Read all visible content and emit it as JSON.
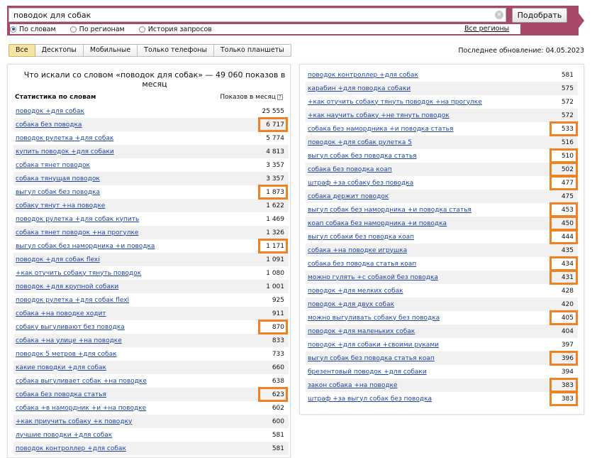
{
  "search": {
    "query": "поводок для собак",
    "submit_label": "Подобрать",
    "clear_icon": "clear-icon",
    "radios": [
      {
        "label": "По словам",
        "selected": true
      },
      {
        "label": "По регионам",
        "selected": false
      },
      {
        "label": "История запросов",
        "selected": false
      }
    ],
    "regions_link": "Все регионы"
  },
  "tabs": [
    "Все",
    "Десктопы",
    "Мобильные",
    "Только телефоны",
    "Только планшеты"
  ],
  "active_tab": "Все",
  "last_update": "Последнее обновление: 04.05.2023",
  "left_panel": {
    "title": "Что искали со словом «поводок для собак» — 49 060 показов в месяц",
    "col_words": "Статистика по словам",
    "col_shows": "Показов в месяц",
    "rows": [
      {
        "phrase": "поводок +для собак",
        "count": "25 555",
        "highlight": false
      },
      {
        "phrase": "собака без поводка",
        "count": "6 717",
        "highlight": true
      },
      {
        "phrase": "поводок рулетка +для собак",
        "count": "5 774",
        "highlight": false
      },
      {
        "phrase": "купить поводок +для собаки",
        "count": "4 813",
        "highlight": false
      },
      {
        "phrase": "собака тянет поводок",
        "count": "3 357",
        "highlight": false
      },
      {
        "phrase": "собака тянущая поводок",
        "count": "3 357",
        "highlight": false
      },
      {
        "phrase": "выгул собак без поводка",
        "count": "1 873",
        "highlight": true
      },
      {
        "phrase": "собаку тянут +на поводке",
        "count": "1 622",
        "highlight": false
      },
      {
        "phrase": "поводок рулетка +для собак купить",
        "count": "1 469",
        "highlight": false
      },
      {
        "phrase": "собака тянет поводок +на прогулке",
        "count": "1 326",
        "highlight": false
      },
      {
        "phrase": "выгул собак без намордника +и поводка",
        "count": "1 171",
        "highlight": true
      },
      {
        "phrase": "поводок +для собак flexi",
        "count": "1 091",
        "highlight": false
      },
      {
        "phrase": "+как отучить собаку тянуть поводок",
        "count": "1 080",
        "highlight": false
      },
      {
        "phrase": "поводок +для крупной собаки",
        "count": "1 001",
        "highlight": false
      },
      {
        "phrase": "поводок рулетка +для собак flexi",
        "count": "925",
        "highlight": false
      },
      {
        "phrase": "собака +на поводке ходит",
        "count": "911",
        "highlight": false
      },
      {
        "phrase": "собаку выгуливают без поводка",
        "count": "870",
        "highlight": true
      },
      {
        "phrase": "собака +на улице +на поводке",
        "count": "833",
        "highlight": false
      },
      {
        "phrase": "поводок 5 метров +для собак",
        "count": "733",
        "highlight": false
      },
      {
        "phrase": "какие поводки +для собак",
        "count": "660",
        "highlight": false
      },
      {
        "phrase": "собака выгуливает собак +на поводке",
        "count": "638",
        "highlight": false
      },
      {
        "phrase": "собака без поводка статья",
        "count": "623",
        "highlight": true
      },
      {
        "phrase": "собака +в намордник +и +на поводке",
        "count": "602",
        "highlight": false
      },
      {
        "phrase": "+как приучить собаку +к поводку",
        "count": "600",
        "highlight": false
      },
      {
        "phrase": "лучшие поводки +для собак",
        "count": "581",
        "highlight": false
      },
      {
        "phrase": "поводок контроллер +для собак",
        "count": "581",
        "highlight": false
      }
    ]
  },
  "right_panel": {
    "rows": [
      {
        "phrase": "поводок контроллер +для собак",
        "count": "581",
        "highlight": false
      },
      {
        "phrase": "карабин +для поводка собаки",
        "count": "575",
        "highlight": false
      },
      {
        "phrase": "+как отучить собаку тянуть поводок +на прогулке",
        "count": "572",
        "highlight": false
      },
      {
        "phrase": "+как научить собаку +не тянуть поводок",
        "count": "572",
        "highlight": false
      },
      {
        "phrase": "собака без намордника +и поводка статья",
        "count": "533",
        "highlight": true
      },
      {
        "phrase": "поводок +для собак рулетка 5",
        "count": "516",
        "highlight": false
      },
      {
        "phrase": "выгул собак без поводка статья",
        "count": "510",
        "highlight": true
      },
      {
        "phrase": "собака без поводка коап",
        "count": "502",
        "highlight": true
      },
      {
        "phrase": "штраф +за собаку без поводка",
        "count": "477",
        "highlight": true
      },
      {
        "phrase": "собака держит поводок",
        "count": "475",
        "highlight": false
      },
      {
        "phrase": "выгул собак без намордника +и поводка статья",
        "count": "453",
        "highlight": true
      },
      {
        "phrase": "коап собака без намордника +и поводка",
        "count": "450",
        "highlight": true
      },
      {
        "phrase": "выгул собаки без поводка коап",
        "count": "444",
        "highlight": true
      },
      {
        "phrase": "собака +на поводке игрушка",
        "count": "435",
        "highlight": false
      },
      {
        "phrase": "собака без поводка статья коап",
        "count": "434",
        "highlight": true
      },
      {
        "phrase": "можно гулять +с собакой без поводка",
        "count": "431",
        "highlight": true
      },
      {
        "phrase": "поводок +для мелких собак",
        "count": "428",
        "highlight": false
      },
      {
        "phrase": "поводок +для двух собак",
        "count": "420",
        "highlight": false
      },
      {
        "phrase": "можно выгуливать собаку без поводка",
        "count": "405",
        "highlight": true
      },
      {
        "phrase": "поводок +для маленьких собак",
        "count": "404",
        "highlight": false
      },
      {
        "phrase": "поводок +для собаки +своими руками",
        "count": "397",
        "highlight": false
      },
      {
        "phrase": "выгул собак без поводка статья коап",
        "count": "396",
        "highlight": true
      },
      {
        "phrase": "брезентовый поводок +для собаки",
        "count": "394",
        "highlight": false
      },
      {
        "phrase": "закон собака +на поводке",
        "count": "383",
        "highlight": true
      },
      {
        "phrase": "штраф +за выгул собак без поводка",
        "count": "383",
        "highlight": true
      }
    ]
  },
  "colors": {
    "brand_band": "#a6496b",
    "link": "#2045a8",
    "highlight_box": "#f08224",
    "active_tab": "#f4e6a2"
  }
}
